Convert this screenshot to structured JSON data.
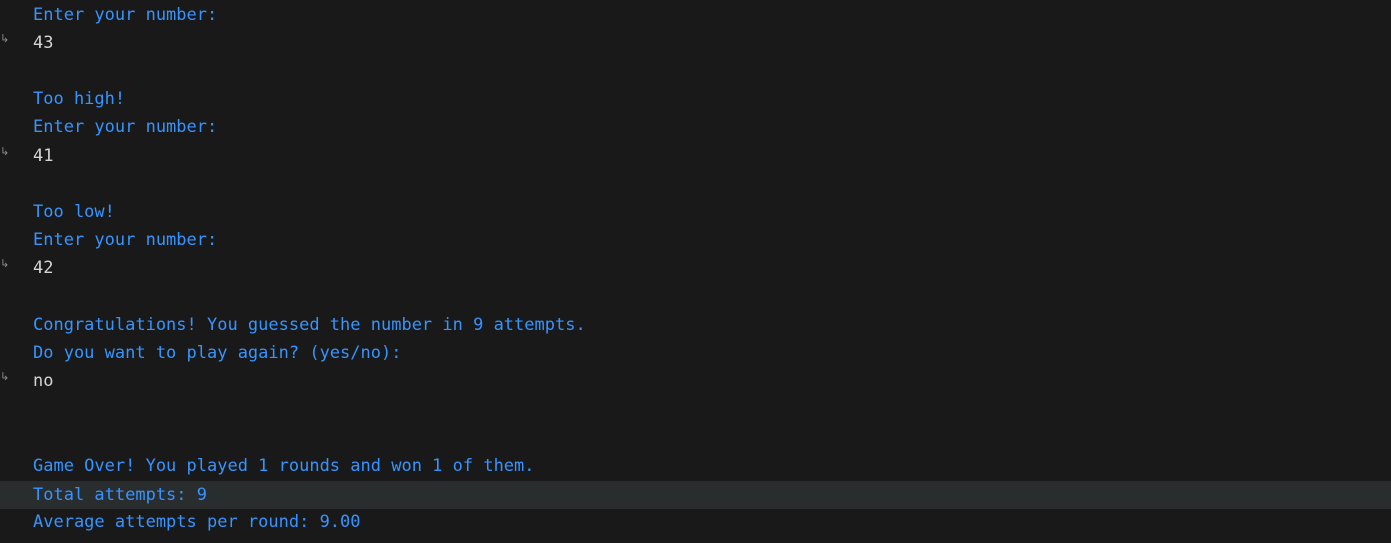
{
  "colors": {
    "background": "#191919",
    "output_text": "#3794ff",
    "input_text": "#d4d4d4",
    "highlight_row": "#2a2d2e",
    "arrow": "#8a8a8a"
  },
  "input_marker": "↳",
  "lines": [
    {
      "kind": "output",
      "text": "Enter your number:"
    },
    {
      "kind": "input",
      "text": "43"
    },
    {
      "kind": "output",
      "text": "Too high!"
    },
    {
      "kind": "output",
      "text": "Enter your number:"
    },
    {
      "kind": "input",
      "text": "41"
    },
    {
      "kind": "output",
      "text": "Too low!"
    },
    {
      "kind": "output",
      "text": "Enter your number:"
    },
    {
      "kind": "input",
      "text": "42"
    },
    {
      "kind": "output",
      "text": "Congratulations! You guessed the number in 9 attempts."
    },
    {
      "kind": "output",
      "text": "Do you want to play again? (yes/no):"
    },
    {
      "kind": "input",
      "text": "no"
    },
    {
      "kind": "output",
      "text": "Game Over! You played 1 rounds and won 1 of them."
    },
    {
      "kind": "output",
      "text": "Total attempts: 9",
      "highlighted": true
    },
    {
      "kind": "output",
      "text": "Average attempts per round: 9.00"
    }
  ]
}
